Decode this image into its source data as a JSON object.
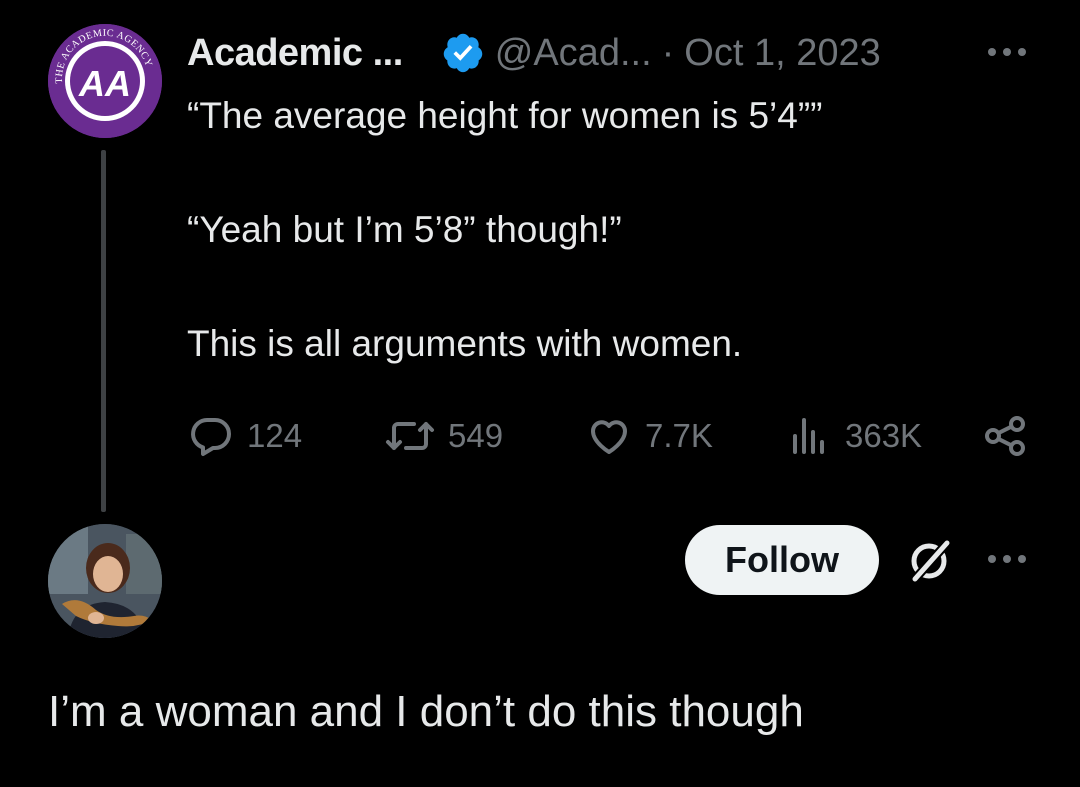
{
  "original_tweet": {
    "author_name": "Academic ...",
    "handle": "@Acad...",
    "separator": "·",
    "date": "Oct 1, 2023",
    "lines": [
      "“The average height for women is 5’4””",
      "“Yeah but I’m 5’8” though!”",
      "This is all arguments with women."
    ],
    "stats": {
      "replies": "124",
      "reposts": "549",
      "likes": "7.7K",
      "views": "363K"
    },
    "avatar_logo_text": "THE ACADEMIC AGENCY",
    "avatar_logo_initials": "AA",
    "accent_color": "#6a2c91"
  },
  "reply": {
    "follow_label": "Follow",
    "text": "I’m a woman and I don’t do this though"
  },
  "colors": {
    "background": "#000000",
    "text_primary": "#e7e9ea",
    "text_secondary": "#71767b",
    "verified_blue": "#1d9bf0",
    "follow_bg": "#eff3f4"
  }
}
